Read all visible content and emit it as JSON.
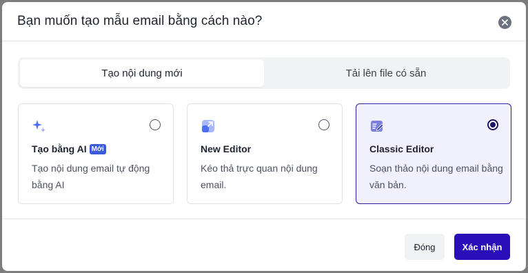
{
  "dialog": {
    "title": "Bạn muốn tạo mẫu email bằng cách nào?",
    "close_icon": "close-icon"
  },
  "tabs": [
    {
      "label": "Tạo nội dung mới",
      "active": true
    },
    {
      "label": "Tải lên file có sẵn",
      "active": false
    }
  ],
  "cards": [
    {
      "title": "Tạo bằng AI",
      "badge": "Mới",
      "description": "Tạo nội dung email tự động bằng AI",
      "icon": "sparkle-icon",
      "selected": false
    },
    {
      "title": "New Editor",
      "description": "Kéo thả trực quan nội dung email.",
      "icon": "expand-icon",
      "selected": false
    },
    {
      "title": "Classic Editor",
      "description": "Soạn thảo nội dung email bằng văn bản.",
      "icon": "edit-document-icon",
      "selected": true
    }
  ],
  "footer": {
    "close_label": "Đóng",
    "confirm_label": "Xác nhận"
  },
  "colors": {
    "primary": "#2a0fb8",
    "selected_card_bg": "#f1f0fd",
    "badge": "#3b5bdb",
    "icon_blue": "#4f6ef7",
    "icon_purple": "#7b7fe0"
  }
}
